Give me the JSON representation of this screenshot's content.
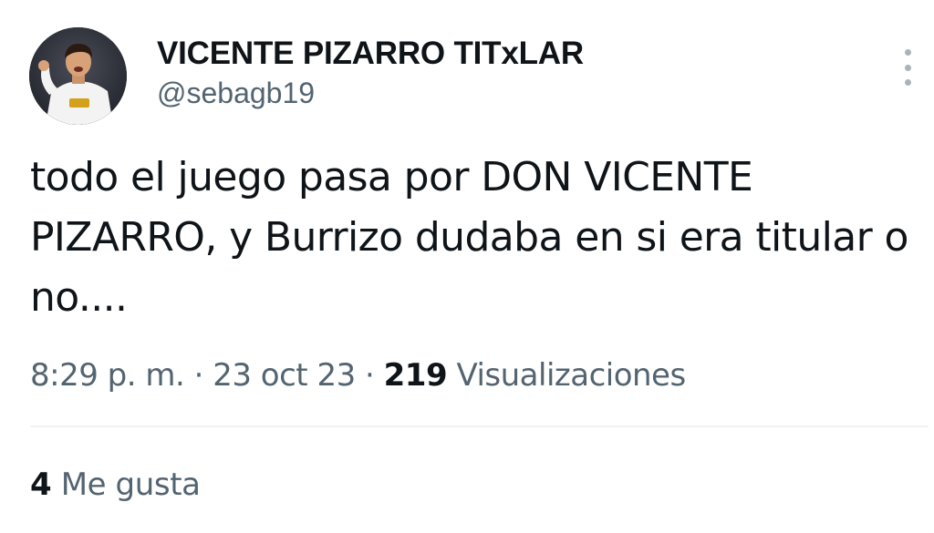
{
  "tweet": {
    "author": {
      "display_name": "VICENTE PIZARRO TITxLAR",
      "handle": "@sebagb19"
    },
    "text": "todo el juego pasa por DON VICENTE PIZARRO, y Burrizo dudaba en si era titular o no....",
    "time": "8:29 p. m.",
    "separator": "·",
    "date": "23 oct 23",
    "views_count": "219",
    "views_label": "Visualizaciones",
    "likes_count": "4",
    "likes_label": "Me gusta"
  },
  "icons": {
    "more": "more-vertical-icon"
  },
  "colors": {
    "text_primary": "#0f1419",
    "text_secondary": "#536471",
    "divider": "#eff3f4"
  }
}
